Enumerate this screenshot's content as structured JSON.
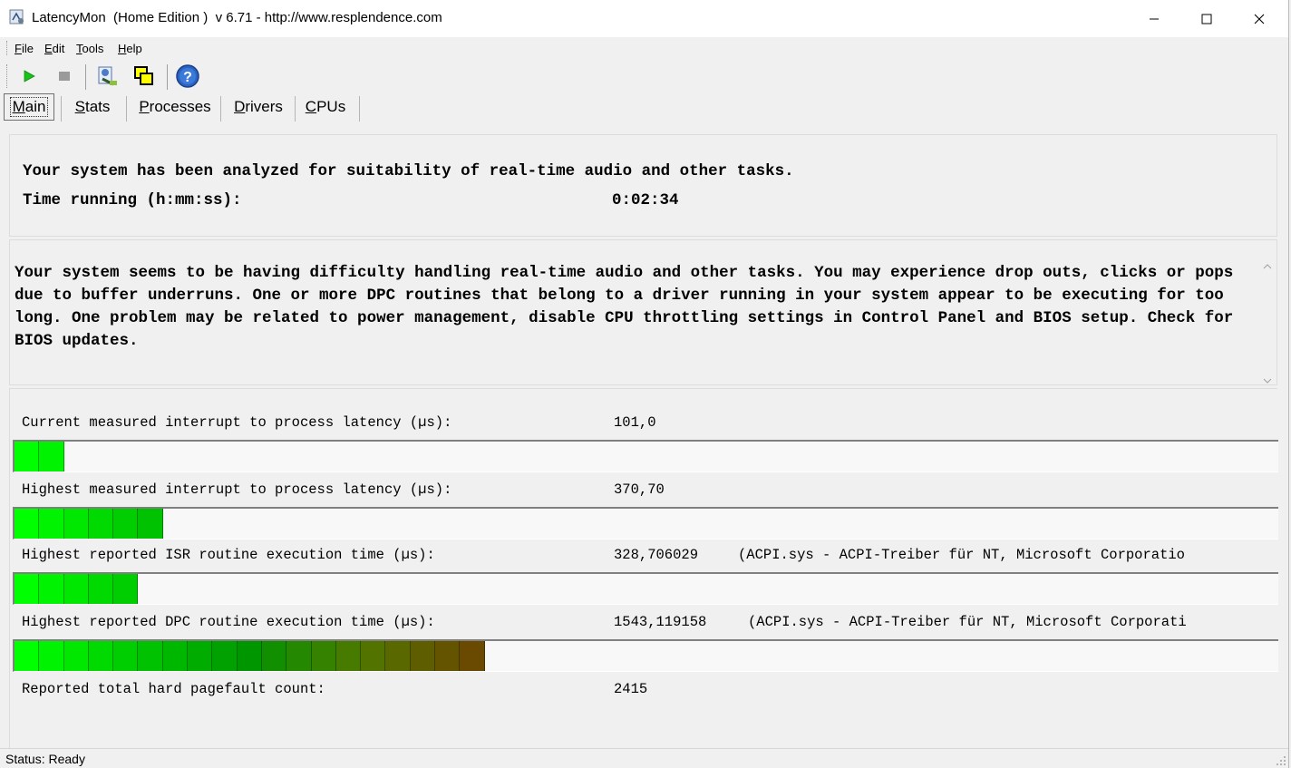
{
  "window": {
    "title": "LatencyMon  (Home Edition )  v 6.71 - http://www.resplendence.com"
  },
  "menu": [
    "File",
    "Edit",
    "Tools",
    "Help"
  ],
  "toolbar": {
    "buttons": [
      "play-icon",
      "stop-icon",
      "report-icon",
      "copy-windows-icon",
      "help-icon"
    ]
  },
  "tabs": [
    "Main",
    "Stats",
    "Processes",
    "Drivers",
    "CPUs"
  ],
  "active_tab": "Main",
  "summary": {
    "line1": "Your system has been analyzed for suitability of real-time audio and other tasks.",
    "time_label": "Time running (h:mm:ss):",
    "time_value": "0:02:34"
  },
  "diagnosis": {
    "text": "Your system seems to be having difficulty handling real-time audio and other tasks. You may experience drop outs, clicks or pops due to buffer underruns. One or more DPC routines that belong to a driver running in your system appear to be executing for too long. One problem may be related to power management, disable CPU throttling settings in Control Panel and BIOS setup. Check for BIOS updates."
  },
  "metrics": [
    {
      "label": "Current measured interrupt to process latency (µs):",
      "value": "101,0",
      "extra": "",
      "bar_segments": 2
    },
    {
      "label": "Highest measured interrupt to process latency (µs):",
      "value": "370,70",
      "extra": "",
      "bar_segments": 6
    },
    {
      "label": "Highest reported ISR routine execution time (µs):",
      "value": "328,706029",
      "extra": "(ACPI.sys - ACPI-Treiber für NT, Microsoft Corporatio",
      "bar_segments": 5
    },
    {
      "label": "Highest reported DPC routine execution time (µs):",
      "value": "1543,119158",
      "extra": "(ACPI.sys - ACPI-Treiber für NT, Microsoft Corporati",
      "bar_segments": 19
    },
    {
      "label": "Reported total hard pagefault count:",
      "value": "2415",
      "extra": ""
    }
  ],
  "colors": {
    "bar_green_bright": "#00ff00",
    "bar_green_dark": "#00a000",
    "bar_olive": "#6b6000",
    "bar_brown": "#6a4a00"
  },
  "status": {
    "text": "Status: Ready"
  }
}
